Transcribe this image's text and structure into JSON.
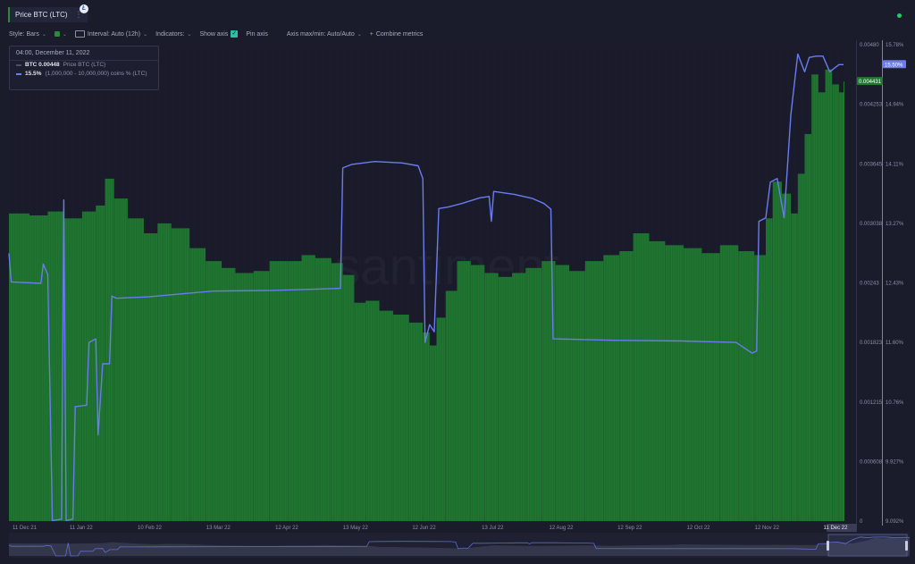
{
  "header": {
    "metric_title": "Price BTC (LTC)",
    "menu_icon": "vertical-dots-icon",
    "coin_icon": "litecoin-icon",
    "coin_glyph": "Ł"
  },
  "toolbar": {
    "style_label": "Style: Bars",
    "interval_label": "Interval: Auto (12h)",
    "indicators_label": "Indicators:",
    "show_axis_label": "Show axis",
    "pin_axis_label": "Pin axis",
    "axis_maxmin_label": "Axis max/min: Auto/Auto",
    "combine_label": "Combine metrics",
    "combine_glyph": "+",
    "chevron_glyph": "⌄",
    "check_glyph": "✓"
  },
  "tooltip": {
    "date": "04:00, December 11, 2022",
    "rows": [
      {
        "value": "BTC 0.00448",
        "label": "Price BTC (LTC)",
        "color": "#2a8c3a"
      },
      {
        "value": "15.5%",
        "label": "(1,000,000 - 10,000,000) coins % (LTC)",
        "color": "#6f7df0"
      }
    ]
  },
  "watermark": "santiment",
  "colors": {
    "background": "#1a1b2b",
    "price_bars": "#1f7a30",
    "supply_line": "#6c7bf0",
    "live_indicator": "#26c96a"
  },
  "chart_data": {
    "type": "bar",
    "x_start": "2021-12-11",
    "x_end": "2022-12-11",
    "x_ticks": [
      "11 Dec 21",
      "11 Jan 22",
      "10 Feb 22",
      "13 Mar 22",
      "12 Apr 22",
      "13 May 22",
      "12 Jun 22",
      "13 Jul 22",
      "12 Aug 22",
      "12 Sep 22",
      "12 Oct 22",
      "12 Nov 22",
      "11 Dec 22"
    ],
    "y_left_ticks": [
      "0.00480",
      "0.004253",
      "0.003645",
      "0.003038",
      "0.00243",
      "0.001823",
      "0.001215",
      "0.000608",
      "0"
    ],
    "y_right_ticks": [
      "15.78%",
      "14.94%",
      "14.11%",
      "13.27%",
      "12.43%",
      "11.60%",
      "10.76%",
      "9.927%",
      "9.092%"
    ],
    "y_left_range": [
      0,
      0.0048
    ],
    "y_right_range": [
      9.092,
      15.78
    ],
    "current_price_label": "0.004431",
    "current_supply_label": "15.50%",
    "series": [
      {
        "name": "Price BTC (LTC)",
        "kind": "bars",
        "axis": "left",
        "points": [
          [
            "2021-12-11",
            0.0031
          ],
          [
            "2021-12-20",
            0.00308
          ],
          [
            "2021-12-28",
            0.00312
          ],
          [
            "2022-01-04",
            0.00305
          ],
          [
            "2022-01-12",
            0.00312
          ],
          [
            "2022-01-18",
            0.00318
          ],
          [
            "2022-01-22",
            0.00345
          ],
          [
            "2022-01-26",
            0.00325
          ],
          [
            "2022-02-01",
            0.00305
          ],
          [
            "2022-02-08",
            0.0029
          ],
          [
            "2022-02-14",
            0.003
          ],
          [
            "2022-02-20",
            0.00295
          ],
          [
            "2022-02-28",
            0.00275
          ],
          [
            "2022-03-07",
            0.00262
          ],
          [
            "2022-03-14",
            0.00255
          ],
          [
            "2022-03-20",
            0.0025
          ],
          [
            "2022-03-28",
            0.00252
          ],
          [
            "2022-04-04",
            0.00262
          ],
          [
            "2022-04-12",
            0.00262
          ],
          [
            "2022-04-18",
            0.00268
          ],
          [
            "2022-04-24",
            0.00265
          ],
          [
            "2022-05-01",
            0.0026
          ],
          [
            "2022-05-06",
            0.00248
          ],
          [
            "2022-05-11",
            0.0022
          ],
          [
            "2022-05-16",
            0.00222
          ],
          [
            "2022-05-22",
            0.00212
          ],
          [
            "2022-05-28",
            0.00208
          ],
          [
            "2022-06-04",
            0.002
          ],
          [
            "2022-06-10",
            0.0019
          ],
          [
            "2022-06-13",
            0.00177
          ],
          [
            "2022-06-16",
            0.00205
          ],
          [
            "2022-06-20",
            0.00232
          ],
          [
            "2022-06-25",
            0.00262
          ],
          [
            "2022-07-01",
            0.00258
          ],
          [
            "2022-07-07",
            0.0025
          ],
          [
            "2022-07-13",
            0.00246
          ],
          [
            "2022-07-19",
            0.0025
          ],
          [
            "2022-07-25",
            0.00255
          ],
          [
            "2022-08-01",
            0.00262
          ],
          [
            "2022-08-07",
            0.00258
          ],
          [
            "2022-08-13",
            0.00252
          ],
          [
            "2022-08-20",
            0.00262
          ],
          [
            "2022-08-28",
            0.00268
          ],
          [
            "2022-09-04",
            0.00272
          ],
          [
            "2022-09-10",
            0.0029
          ],
          [
            "2022-09-17",
            0.00282
          ],
          [
            "2022-09-24",
            0.00278
          ],
          [
            "2022-10-02",
            0.00275
          ],
          [
            "2022-10-10",
            0.0027
          ],
          [
            "2022-10-18",
            0.00278
          ],
          [
            "2022-10-26",
            0.00272
          ],
          [
            "2022-11-02",
            0.00268
          ],
          [
            "2022-11-07",
            0.00305
          ],
          [
            "2022-11-10",
            0.00342
          ],
          [
            "2022-11-14",
            0.0033
          ],
          [
            "2022-11-18",
            0.0031
          ],
          [
            "2022-11-21",
            0.0035
          ],
          [
            "2022-11-24",
            0.0039
          ],
          [
            "2022-11-27",
            0.0045
          ],
          [
            "2022-11-30",
            0.00432
          ],
          [
            "2022-12-03",
            0.00455
          ],
          [
            "2022-12-06",
            0.0044
          ],
          [
            "2022-12-09",
            0.00432
          ],
          [
            "2022-12-11",
            0.00443
          ]
        ]
      },
      {
        "name": "(1,000,000 - 10,000,000) coins % (LTC)",
        "kind": "line",
        "axis": "right",
        "points": [
          [
            "2021-12-11",
            12.85
          ],
          [
            "2021-12-12",
            12.45
          ],
          [
            "2021-12-25",
            12.43
          ],
          [
            "2021-12-26",
            12.7
          ],
          [
            "2021-12-28",
            12.55
          ],
          [
            "2021-12-30",
            9.1
          ],
          [
            "2022-01-03",
            9.12
          ],
          [
            "2022-01-04",
            13.6
          ],
          [
            "2022-01-05",
            9.1
          ],
          [
            "2022-01-08",
            9.12
          ],
          [
            "2022-01-09",
            10.7
          ],
          [
            "2022-01-14",
            10.72
          ],
          [
            "2022-01-15",
            11.6
          ],
          [
            "2022-01-18",
            11.65
          ],
          [
            "2022-01-19",
            10.3
          ],
          [
            "2022-01-21",
            11.3
          ],
          [
            "2022-01-24",
            11.3
          ],
          [
            "2022-01-25",
            12.25
          ],
          [
            "2022-01-27",
            12.22
          ],
          [
            "2022-02-10",
            12.24
          ],
          [
            "2022-03-10",
            12.32
          ],
          [
            "2022-04-05",
            12.33
          ],
          [
            "2022-04-25",
            12.35
          ],
          [
            "2022-05-05",
            12.36
          ],
          [
            "2022-05-06",
            14.05
          ],
          [
            "2022-05-10",
            14.1
          ],
          [
            "2022-05-20",
            14.14
          ],
          [
            "2022-06-01",
            14.12
          ],
          [
            "2022-06-08",
            14.08
          ],
          [
            "2022-06-10",
            13.9
          ],
          [
            "2022-06-11",
            11.6
          ],
          [
            "2022-06-13",
            11.85
          ],
          [
            "2022-06-15",
            11.75
          ],
          [
            "2022-06-17",
            13.48
          ],
          [
            "2022-06-21",
            13.5
          ],
          [
            "2022-06-27",
            13.55
          ],
          [
            "2022-07-05",
            13.63
          ],
          [
            "2022-07-09",
            13.65
          ],
          [
            "2022-07-10",
            13.3
          ],
          [
            "2022-07-11",
            13.72
          ],
          [
            "2022-07-20",
            13.68
          ],
          [
            "2022-07-28",
            13.62
          ],
          [
            "2022-08-02",
            13.55
          ],
          [
            "2022-08-05",
            13.47
          ],
          [
            "2022-08-06",
            11.65
          ],
          [
            "2022-09-01",
            11.63
          ],
          [
            "2022-10-01",
            11.62
          ],
          [
            "2022-10-25",
            11.6
          ],
          [
            "2022-11-01",
            11.45
          ],
          [
            "2022-11-03",
            11.48
          ],
          [
            "2022-11-04",
            13.3
          ],
          [
            "2022-11-07",
            13.35
          ],
          [
            "2022-11-09",
            13.85
          ],
          [
            "2022-11-12",
            13.9
          ],
          [
            "2022-11-15",
            13.35
          ],
          [
            "2022-11-18",
            14.8
          ],
          [
            "2022-11-21",
            15.65
          ],
          [
            "2022-11-24",
            15.4
          ],
          [
            "2022-11-26",
            15.6
          ],
          [
            "2022-11-29",
            15.62
          ],
          [
            "2022-12-02",
            15.62
          ],
          [
            "2022-12-05",
            15.4
          ],
          [
            "2022-12-09",
            15.5
          ],
          [
            "2022-12-11",
            15.5
          ]
        ]
      }
    ],
    "grid": false,
    "legend": "top-left"
  }
}
